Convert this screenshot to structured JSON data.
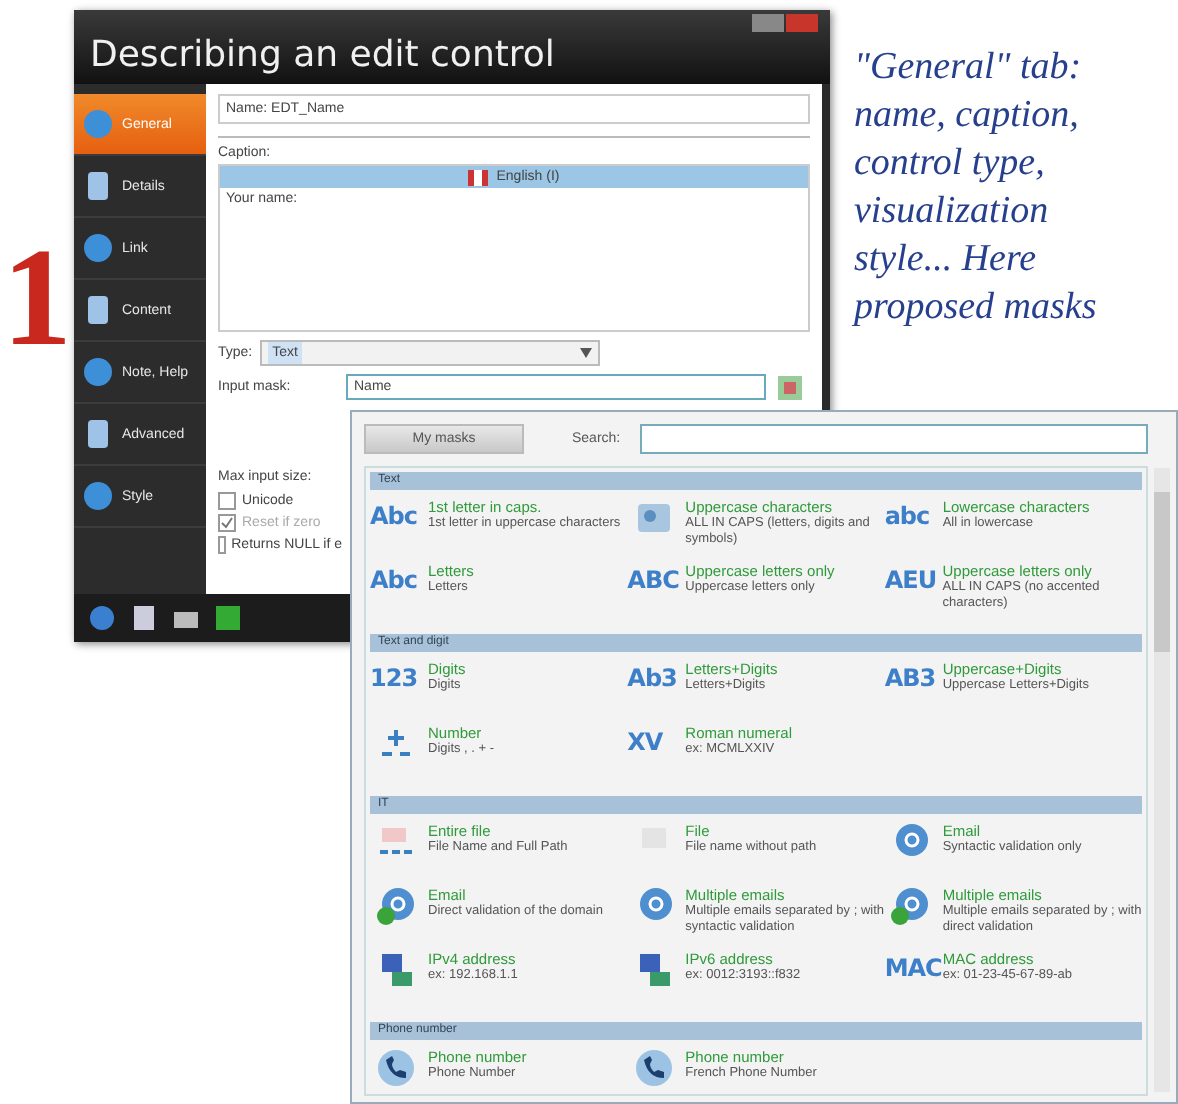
{
  "window": {
    "title": "Describing an edit control"
  },
  "step_number": "1",
  "sidebar": {
    "items": [
      {
        "label": "General",
        "selected": true
      },
      {
        "label": "Details",
        "selected": false
      },
      {
        "label": "Link",
        "selected": false
      },
      {
        "label": "Content",
        "selected": false
      },
      {
        "label": "Note, Help",
        "selected": false
      },
      {
        "label": "Advanced",
        "selected": false
      },
      {
        "label": "Style",
        "selected": false
      }
    ]
  },
  "form": {
    "name_label": "Name:",
    "name_value": "EDT_Name",
    "caption_label": "Caption:",
    "caption_language": "English (I)",
    "caption_text": "Your name:",
    "type_label": "Type:",
    "type_value": "Text",
    "input_mask_label": "Input mask:",
    "input_mask_value": "Name",
    "max_input_label": "Max input size:",
    "options": [
      {
        "label": "Unicode",
        "checked": false,
        "disabled": false
      },
      {
        "label": "Reset if zero",
        "checked": true,
        "disabled": true
      },
      {
        "label": "Returns NULL if e",
        "checked": false,
        "disabled": false
      }
    ]
  },
  "mask_popup": {
    "my_masks_button": "My masks",
    "search_label": "Search:",
    "sections": [
      {
        "title": "Text",
        "items": [
          {
            "name": "1st letter in caps.",
            "description": "1st letter in uppercase characters",
            "kind": "glyph",
            "glyph": "Abc"
          },
          {
            "name": "Uppercase characters",
            "description": "ALL IN CAPS (letters, digits and symbols)",
            "kind": "image"
          },
          {
            "name": "Lowercase characters",
            "description": "All in lowercase",
            "kind": "glyph",
            "glyph": "abc"
          },
          {
            "name": "Letters",
            "description": "Letters",
            "kind": "glyph",
            "glyph": "Abc"
          },
          {
            "name": "Uppercase letters only",
            "description": "Uppercase letters only",
            "kind": "glyph",
            "glyph": "ABC"
          },
          {
            "name": "Uppercase letters only",
            "description": "ALL IN CAPS (no accented characters)",
            "kind": "glyph",
            "glyph": "AEU"
          }
        ]
      },
      {
        "title": "Text and digit",
        "items": [
          {
            "name": "Digits",
            "description": "Digits",
            "kind": "glyph",
            "glyph": "123"
          },
          {
            "name": "Letters+Digits",
            "description": "Letters+Digits",
            "kind": "glyph",
            "glyph": "Ab3"
          },
          {
            "name": "Uppercase+Digits",
            "description": "Uppercase Letters+Digits",
            "kind": "glyph",
            "glyph": "AB3"
          },
          {
            "name": "Number",
            "description": "Digits , . + -",
            "kind": "number"
          },
          {
            "name": "Roman numeral",
            "description": "ex: MCMLXXIV",
            "kind": "glyph",
            "glyph": "XV"
          }
        ]
      },
      {
        "title": "IT",
        "items": [
          {
            "name": "Entire file",
            "description": "File Name and Full Path",
            "kind": "path"
          },
          {
            "name": "File",
            "description": "File name without path",
            "kind": "file"
          },
          {
            "name": "Email",
            "description": "Syntactic validation only",
            "kind": "at"
          },
          {
            "name": "Email",
            "description": "Direct validation of the domain",
            "kind": "at-check"
          },
          {
            "name": "Multiple emails",
            "description": "Multiple emails separated by ; with syntactic validation",
            "kind": "at"
          },
          {
            "name": "Multiple emails",
            "description": "Multiple emails separated by ; with direct validation",
            "kind": "at-check"
          },
          {
            "name": "IPv4 address",
            "description": "ex: 192.168.1.1",
            "kind": "network"
          },
          {
            "name": "IPv6 address",
            "description": "ex: 0012:3193::f832",
            "kind": "network"
          },
          {
            "name": "MAC address",
            "description": "ex: 01-23-45-67-89-ab",
            "kind": "glyph",
            "glyph": "MAC"
          }
        ]
      },
      {
        "title": "Phone number",
        "items": [
          {
            "name": "Phone number",
            "description": "Phone Number",
            "kind": "phone"
          },
          {
            "name": "Phone number",
            "description": "French Phone Number",
            "kind": "phone"
          }
        ]
      }
    ]
  },
  "caption": "\"General\" tab: name, caption, control type, visualization style... Here proposed masks"
}
